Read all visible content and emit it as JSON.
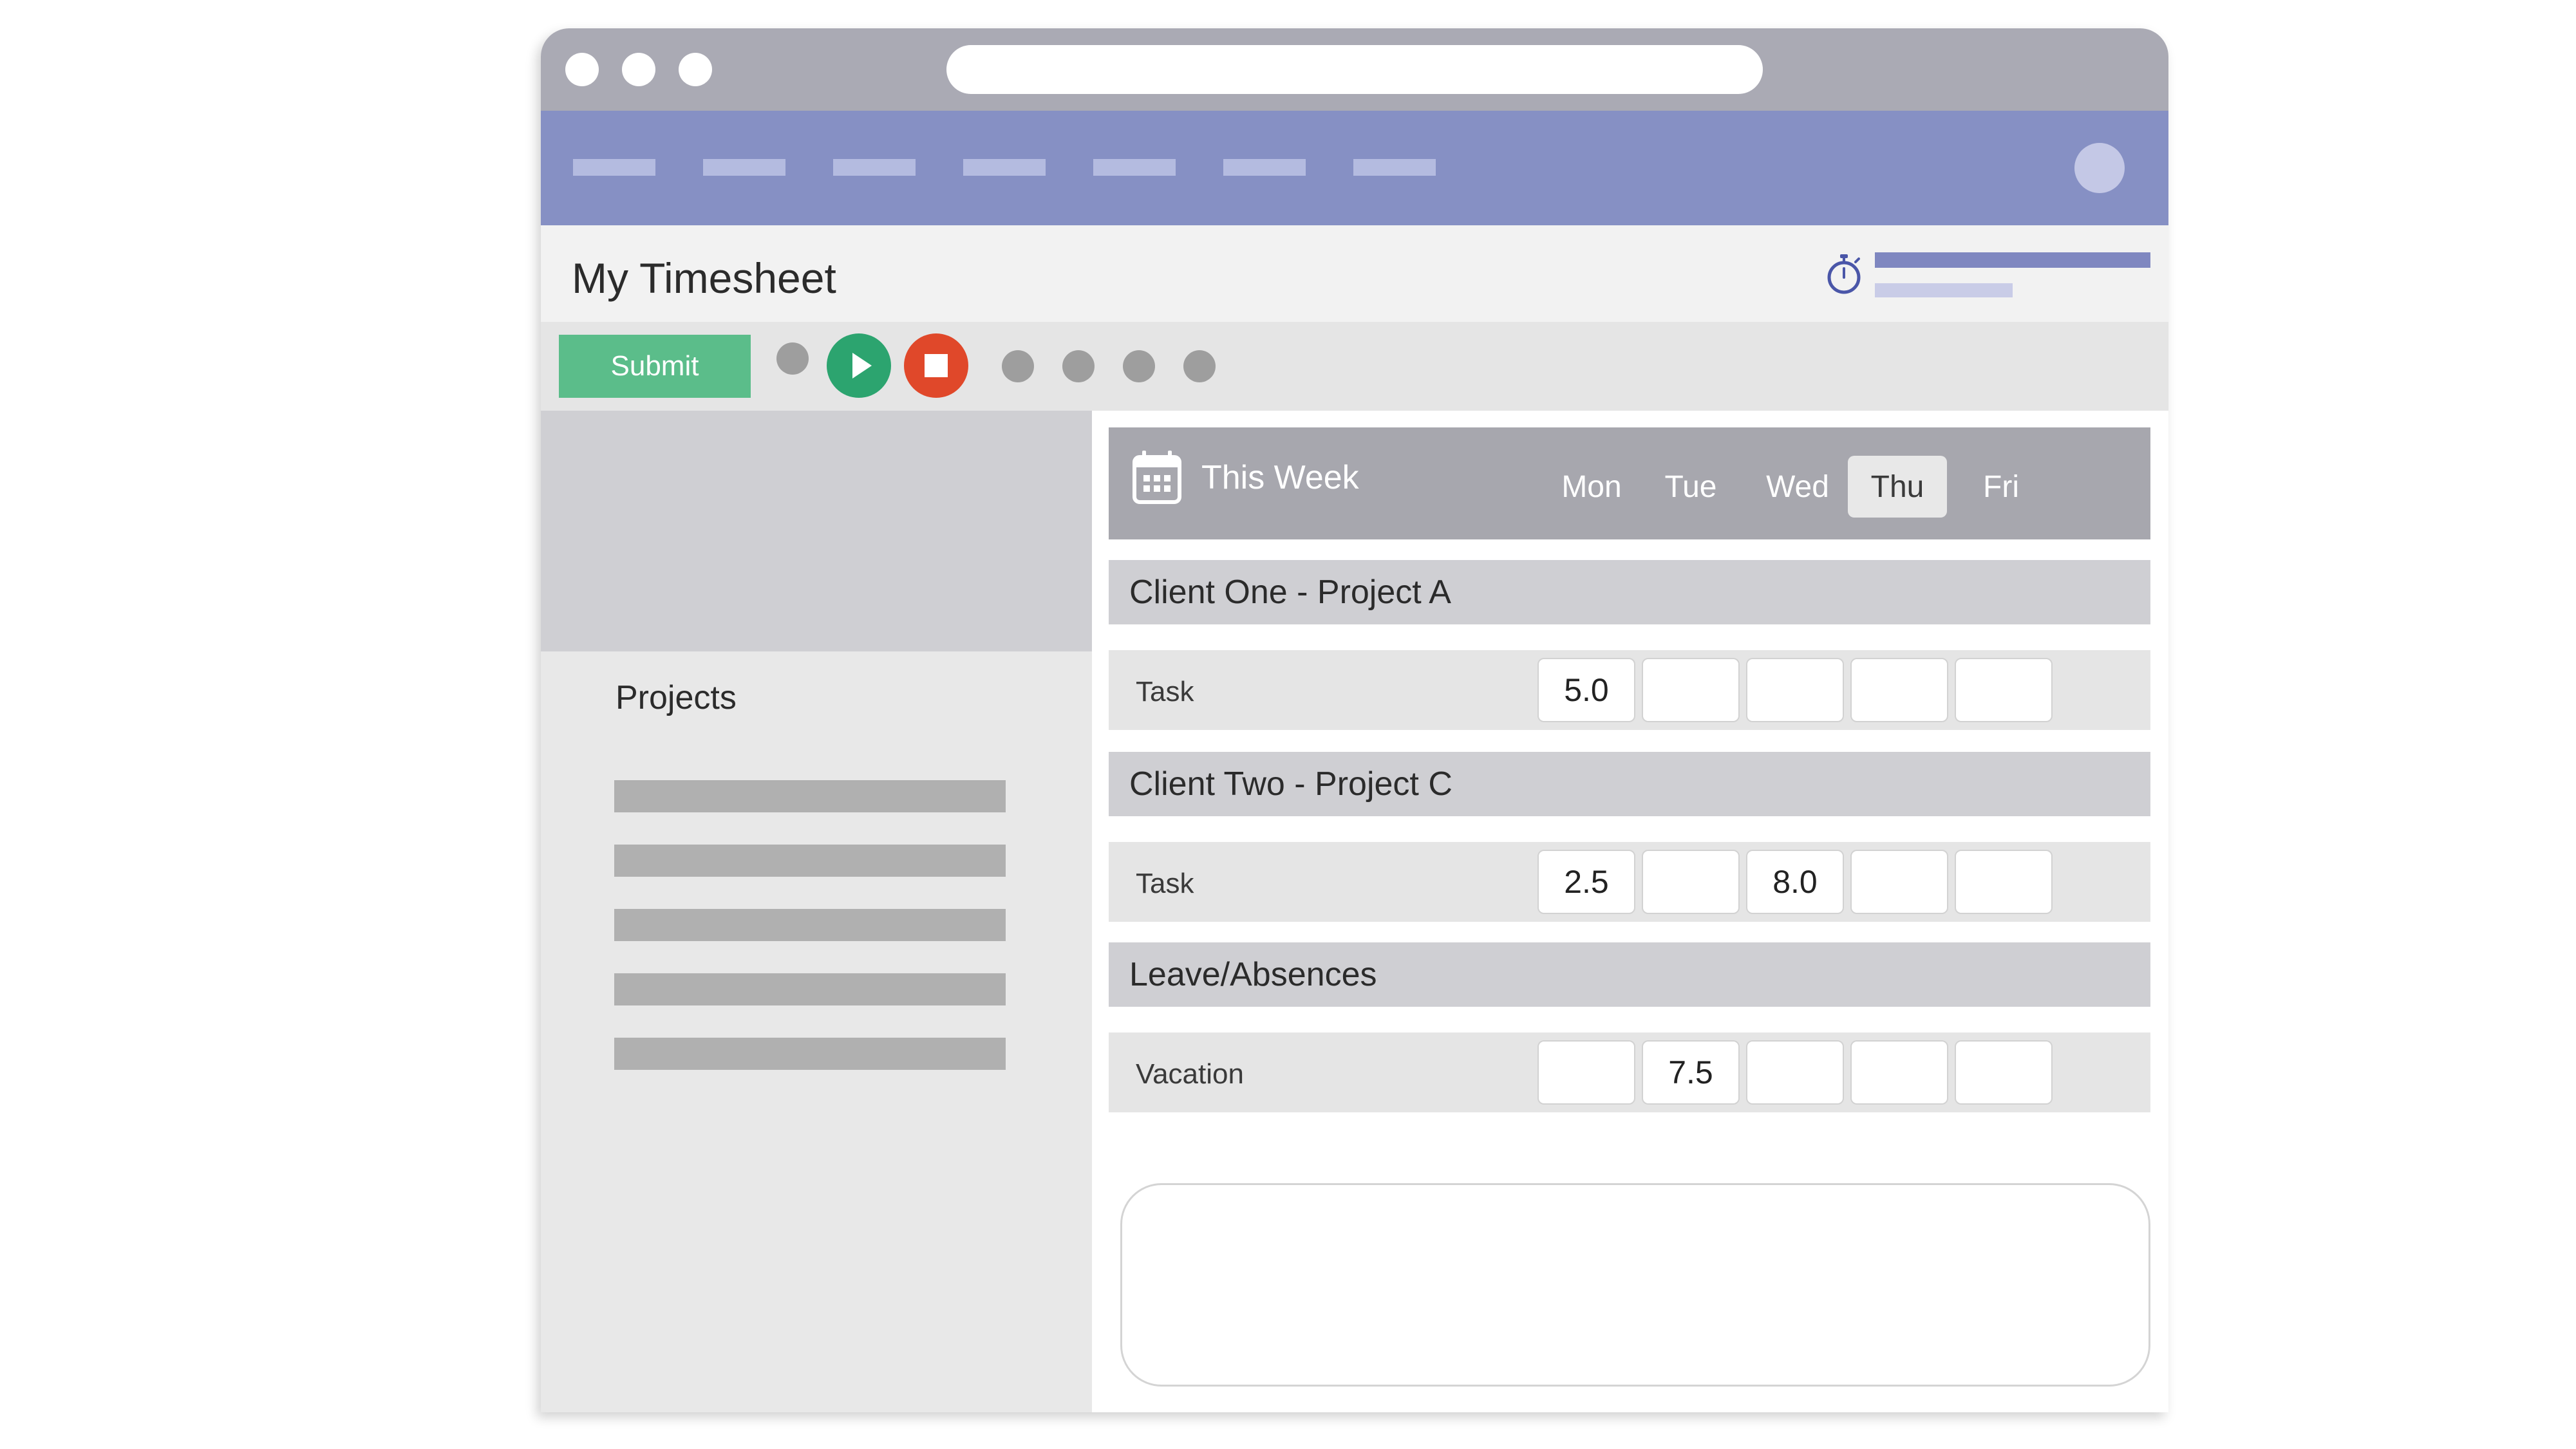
{
  "page": {
    "title": "My Timesheet"
  },
  "toolbar": {
    "submit_label": "Submit"
  },
  "sidebar": {
    "projects_title": "Projects"
  },
  "week": {
    "label": "This Week",
    "days": [
      "Mon",
      "Tue",
      "Wed",
      "Thu",
      "Fri"
    ],
    "active_day": "Thu"
  },
  "groups": [
    {
      "title": "Client One - Project A",
      "row_label": "Task",
      "cells": [
        "5.0",
        "",
        "",
        "",
        ""
      ]
    },
    {
      "title": "Client Two - Project C",
      "row_label": "Task",
      "cells": [
        "2.5",
        "",
        "8.0",
        "",
        ""
      ]
    },
    {
      "title": "Leave/Absences",
      "row_label": "Vacation",
      "cells": [
        "",
        "7.5",
        "",
        "",
        ""
      ]
    }
  ],
  "icons": {
    "timer": "stopwatch-icon",
    "calendar": "calendar-icon",
    "play": "play-icon",
    "stop": "stop-icon"
  },
  "colors": {
    "nav": "#8690c4",
    "submit": "#5bbd8a",
    "play": "#2ca46f",
    "stop": "#e0482a"
  }
}
